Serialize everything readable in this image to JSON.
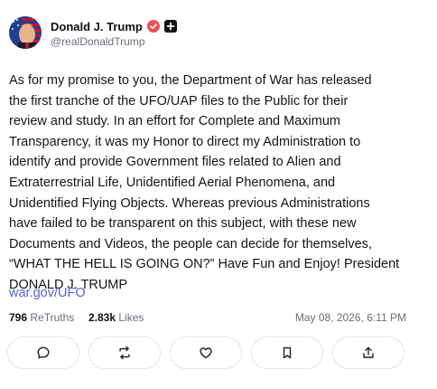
{
  "author": {
    "display_name": "Donald J. Trump",
    "handle": "@realDonaldTrump"
  },
  "post": {
    "lines": [
      "As for my promise to you, the Department of War has released",
      "the first tranche of the UFO/UAP files to the Public for their",
      "review and study. In an effort for Complete and Maximum",
      "Transparency, it was my Honor to direct my Administration to",
      "identify and provide Government files related to Alien and",
      "Extraterrestrial Life, Unidentified Aerial Phenomena, and",
      "Unidentified Flying Objects. Whereas previous Administrations",
      "have failed to be transparent on this subject, with these new",
      "Documents and Videos, the people can decide for themselves,",
      "“WHAT THE HELL IS GOING ON?” Have Fun and Enjoy! President",
      "DONALD J. TRUMP"
    ],
    "link": "war.gov/UFO"
  },
  "stats": {
    "retruths_count": "796",
    "retruths_label": "ReTruths",
    "likes_count": "2.83k",
    "likes_label": "Likes",
    "timestamp": "May 08, 2026, 6:11 PM"
  },
  "actions": {
    "icons": [
      "reply-icon",
      "retruth-icon",
      "like-icon",
      "bookmark-icon",
      "share-icon"
    ]
  },
  "colors": {
    "link": "#5a5fd8",
    "verified": "#e8505b",
    "muted_text": "#6b6f7a",
    "border": "#e4e5ea"
  }
}
